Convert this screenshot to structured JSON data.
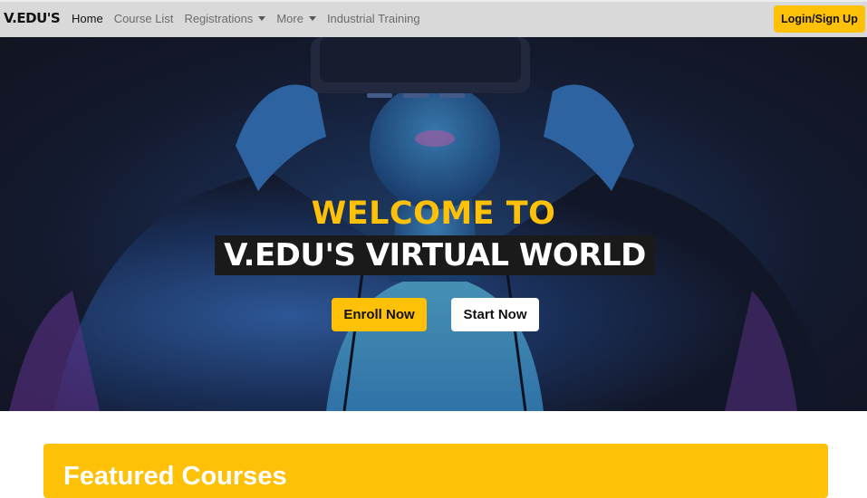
{
  "navbar": {
    "brand": "V.EDU'S",
    "links": [
      {
        "label": "Home"
      },
      {
        "label": "Course List"
      },
      {
        "label": "Registrations"
      },
      {
        "label": "More"
      },
      {
        "label": "Industrial Training"
      }
    ],
    "login_label": "Login/Sign Up"
  },
  "hero": {
    "line1": "WELCOME TO",
    "line2": "V.EDU'S VIRTUAL WORLD",
    "enroll_label": "Enroll Now",
    "start_label": "Start Now"
  },
  "featured": {
    "title": "Featured Courses"
  },
  "colors": {
    "accent": "#ffc107",
    "navbar_bg": "#d9d9d9",
    "headline_bg": "#1a1a1a"
  }
}
